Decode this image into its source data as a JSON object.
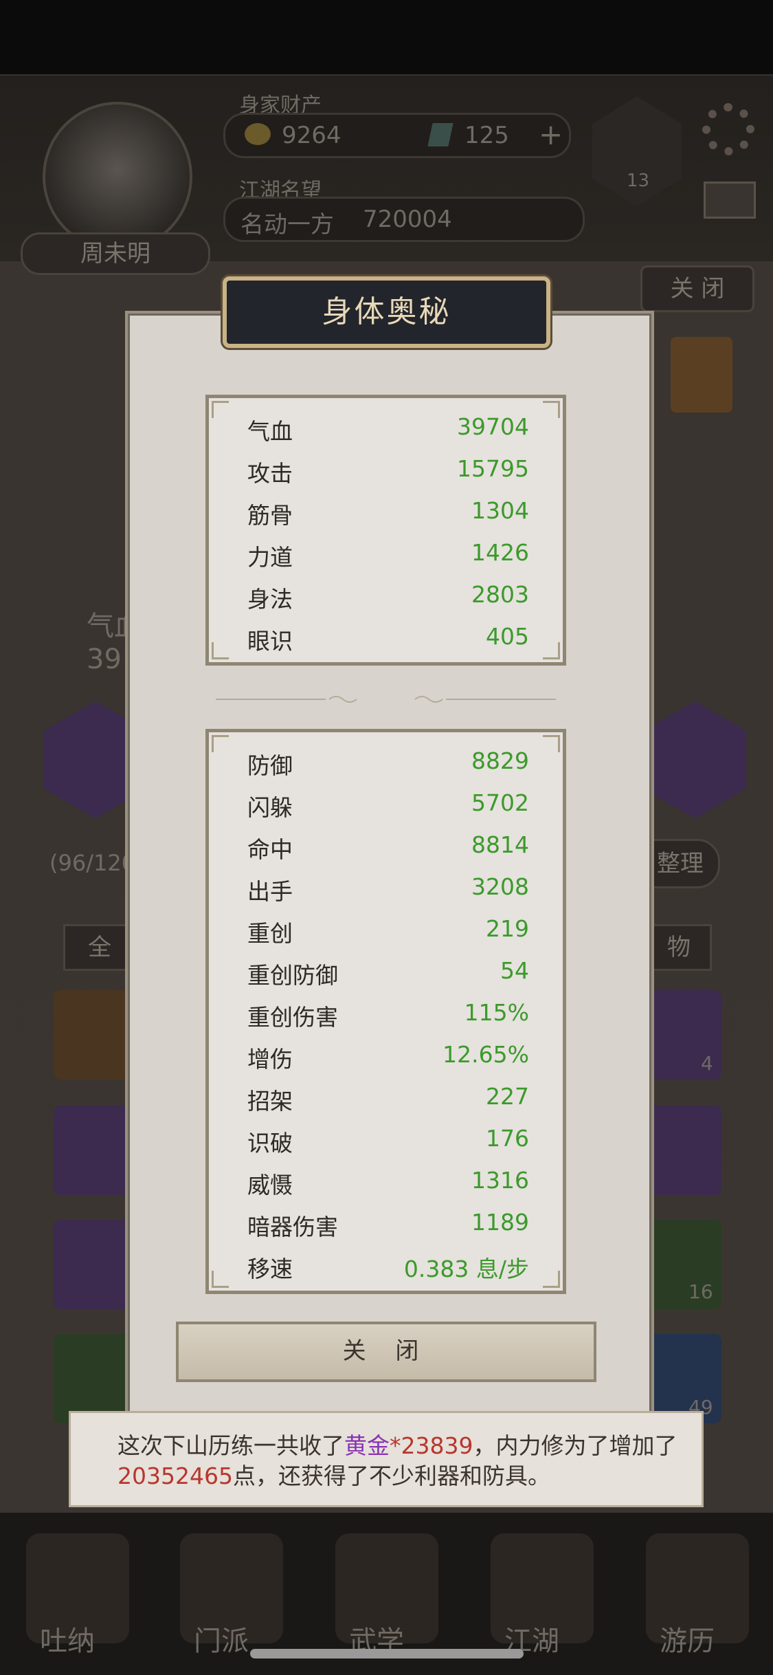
{
  "background": {
    "gold_label": "身家财产",
    "gold": "9264",
    "gems": "125",
    "fame_label": "江湖名望",
    "fame_rank": "名动一方",
    "fame_value": "720004",
    "player_name": "周未明",
    "level": "13",
    "close_tab": "关 闭",
    "hp_label": "气血",
    "hp_partial": "39",
    "bag_count": "(96/120",
    "sort_btn": "整理",
    "filter_all": "全",
    "filter_item": "物",
    "slot_counts": [
      "4",
      "16",
      "49"
    ],
    "nav": [
      "吐纳",
      "门派",
      "武学",
      "江湖",
      "游历"
    ]
  },
  "modal": {
    "title": "身体奥秘",
    "basic_stats": [
      {
        "label": "气血",
        "value": "39704"
      },
      {
        "label": "攻击",
        "value": "15795"
      },
      {
        "label": "筋骨",
        "value": "1304"
      },
      {
        "label": "力道",
        "value": "1426"
      },
      {
        "label": "身法",
        "value": "2803"
      },
      {
        "label": "眼识",
        "value": "405"
      }
    ],
    "advanced_stats": [
      {
        "label": "防御",
        "value": "8829"
      },
      {
        "label": "闪躲",
        "value": "5702"
      },
      {
        "label": "命中",
        "value": "8814"
      },
      {
        "label": "出手",
        "value": "3208"
      },
      {
        "label": "重创",
        "value": "219"
      },
      {
        "label": "重创防御",
        "value": "54"
      },
      {
        "label": "重创伤害",
        "value": "115%"
      },
      {
        "label": "增伤",
        "value": "12.65%"
      },
      {
        "label": "招架",
        "value": "227"
      },
      {
        "label": "识破",
        "value": "176"
      },
      {
        "label": "威慑",
        "value": "1316"
      },
      {
        "label": "暗器伤害",
        "value": "1189"
      },
      {
        "label": "移速",
        "value": "0.383 息/步"
      }
    ],
    "close_label": "关 闭"
  },
  "toast": {
    "part1": "这次下山历练一共收了",
    "item": "黄金",
    "part2": "*",
    "amount": "23839",
    "part3": "，内力修为了增加了",
    "points": "20352465",
    "part4": "点，还获得了不少利器和防具。"
  },
  "colors": {
    "stat_value": "#3b9a2c",
    "highlight_item": "#8a33b5",
    "highlight_number": "#b8362d"
  }
}
